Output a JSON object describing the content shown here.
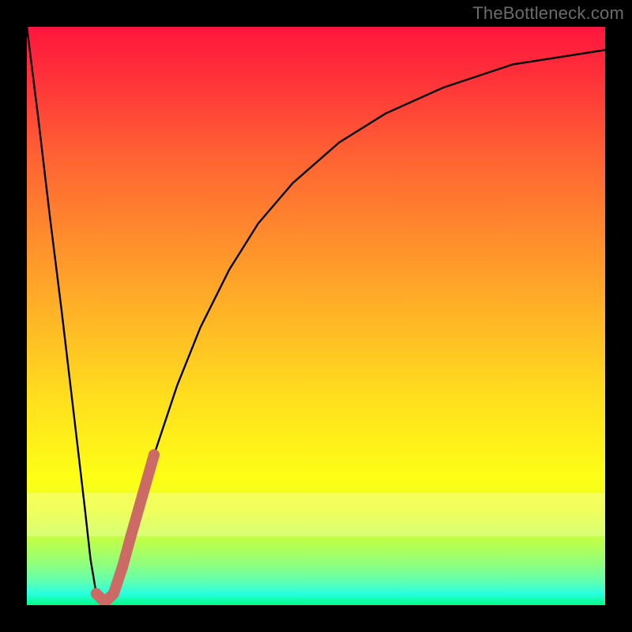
{
  "watermark": "TheBottleneck.com",
  "colors": {
    "background": "#000000",
    "curve": "#000000",
    "marker": "#cc6a66"
  },
  "chart_data": {
    "type": "line",
    "title": "",
    "xlabel": "",
    "ylabel": "",
    "xlim": [
      0,
      100
    ],
    "ylim": [
      0,
      100
    ],
    "grid": false,
    "legend": false,
    "series": [
      {
        "name": "bottleneck-curve",
        "x": [
          0,
          2,
          4,
          6,
          8,
          10,
          11,
          12,
          13.5,
          15,
          18,
          22,
          26,
          30,
          35,
          40,
          46,
          54,
          62,
          72,
          84,
          100
        ],
        "y": [
          100,
          84,
          67,
          51,
          34,
          17,
          8,
          2,
          0,
          2,
          12,
          26,
          38,
          48,
          58,
          66,
          73,
          80,
          85,
          89.5,
          93.5,
          96
        ]
      }
    ],
    "markers": [
      {
        "name": "highlight-segment",
        "color": "#cc6a66",
        "points": [
          {
            "x": 12.0,
            "y": 2.0
          },
          {
            "x": 13.5,
            "y": 0.5
          },
          {
            "x": 15.0,
            "y": 2.0
          },
          {
            "x": 16.5,
            "y": 6.5
          },
          {
            "x": 18.0,
            "y": 12.0
          },
          {
            "x": 20.0,
            "y": 19.0
          },
          {
            "x": 22.0,
            "y": 26.0
          }
        ]
      }
    ]
  }
}
